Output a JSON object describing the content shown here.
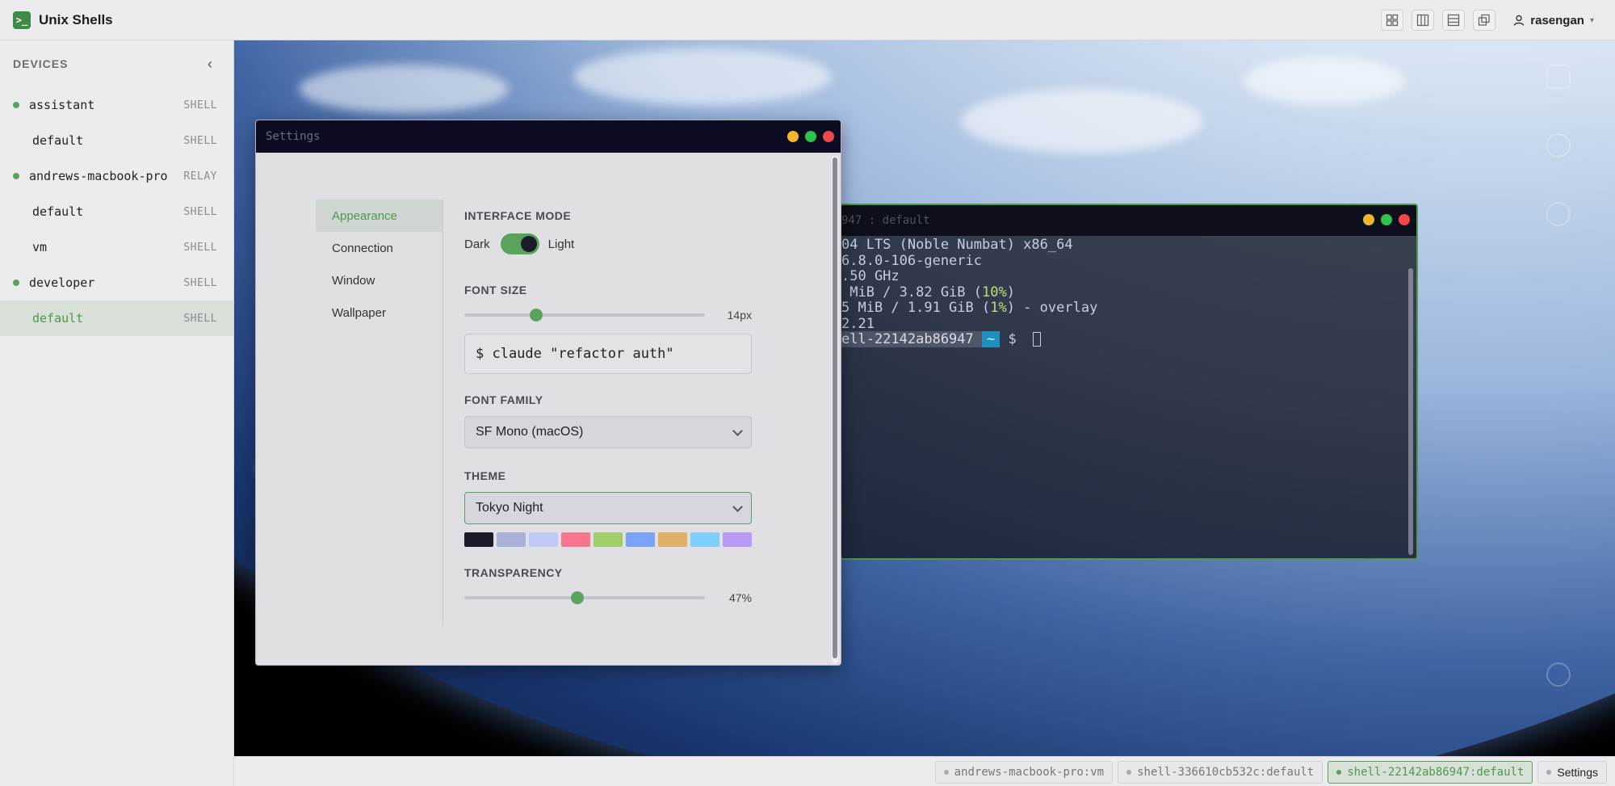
{
  "app": {
    "title": "Unix Shells",
    "logo_glyph": ">_"
  },
  "topbar": {
    "layout_buttons": [
      "grid-layout",
      "columns-layout",
      "rows-layout",
      "stack-layout"
    ],
    "user": "rasengan",
    "user_caret": "▾"
  },
  "sidebar": {
    "header": "DEVICES",
    "collapse_glyph": "‹",
    "items": [
      {
        "name": "assistant",
        "tag": "SHELL",
        "level": 0,
        "online": true,
        "active": false
      },
      {
        "name": "default",
        "tag": "SHELL",
        "level": 1,
        "online": false,
        "active": false
      },
      {
        "name": "andrews-macbook-pro",
        "tag": "RELAY",
        "level": 0,
        "online": true,
        "active": false
      },
      {
        "name": "default",
        "tag": "SHELL",
        "level": 1,
        "online": false,
        "active": false
      },
      {
        "name": "vm",
        "tag": "SHELL",
        "level": 1,
        "online": false,
        "active": false
      },
      {
        "name": "developer",
        "tag": "SHELL",
        "level": 0,
        "online": true,
        "active": false
      },
      {
        "name": "default",
        "tag": "SHELL",
        "level": 1,
        "online": false,
        "active": true
      }
    ]
  },
  "terminal": {
    "title": "947 : default",
    "lines": [
      {
        "parts": [
          {
            "t": "04 LTS (Noble Numbat) x86_64"
          }
        ]
      },
      {
        "parts": [
          {
            "t": "6.8.0-106-generic"
          }
        ]
      },
      {
        "parts": [
          {
            "t": ".50 GHz"
          }
        ]
      },
      {
        "parts": [
          {
            "t": " MiB / 3.82 GiB ("
          },
          {
            "t": "10%",
            "c": "num-green"
          },
          {
            "t": ")"
          }
        ]
      },
      {
        "parts": [
          {
            "t": "5 MiB / 1.91 GiB ("
          },
          {
            "t": "1%",
            "c": "num-green"
          },
          {
            "t": ") - overlay"
          }
        ]
      },
      {
        "parts": [
          {
            "t": "2.21"
          }
        ]
      }
    ],
    "prompt_host": "ell-22142ab86947 ",
    "prompt_path": "~",
    "prompt_symbol": " $ "
  },
  "settings": {
    "title": "Settings",
    "nav": [
      "Appearance",
      "Connection",
      "Window",
      "Wallpaper"
    ],
    "active_nav": "Appearance",
    "interface_mode": {
      "label": "INTERFACE MODE",
      "dark": "Dark",
      "light": "Light",
      "value": "light"
    },
    "font_size": {
      "label": "FONT SIZE",
      "value_text": "14px",
      "fraction": 0.3,
      "preview": "$ claude \"refactor auth\""
    },
    "font_family": {
      "label": "FONT FAMILY",
      "value": "SF Mono (macOS)"
    },
    "theme": {
      "label": "THEME",
      "value": "Tokyo Night",
      "swatches": [
        "#1a1b26",
        "#a9b1d6",
        "#c0caf5",
        "#f7768e",
        "#9ece6a",
        "#7aa2f7",
        "#e0af68",
        "#7dcfff",
        "#bb9af7"
      ]
    },
    "transparency": {
      "label": "TRANSPARENCY",
      "value_text": "47%",
      "fraction": 0.47
    }
  },
  "statusbar": {
    "tabs": [
      {
        "label": "andrews-macbook-pro:vm",
        "active": false
      },
      {
        "label": "shell-336610cb532c:default",
        "active": false
      },
      {
        "label": "shell-22142ab86947:default",
        "active": true
      }
    ],
    "settings_label": "Settings"
  },
  "colors": {
    "accent": "#5aa35c",
    "titlebar": "#0b0c22"
  }
}
